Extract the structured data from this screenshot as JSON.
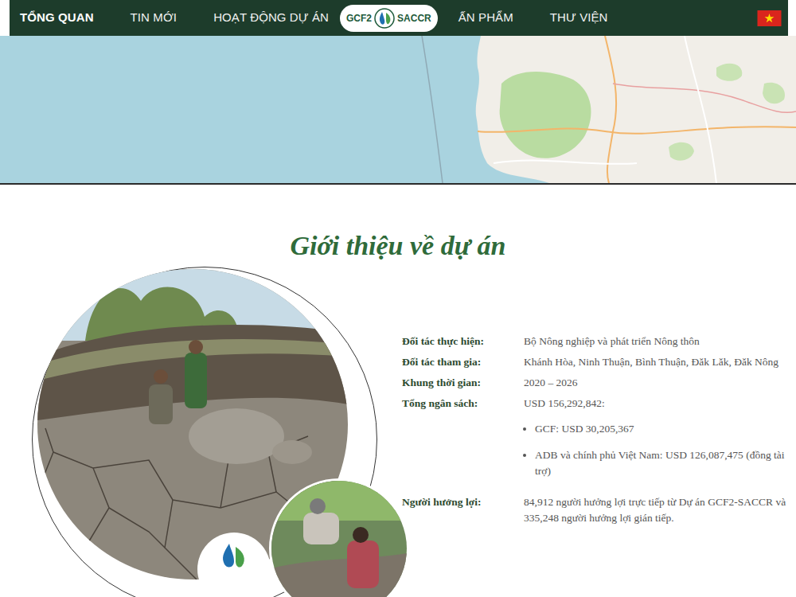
{
  "nav": {
    "items_left": [
      {
        "label": "TỔNG QUAN",
        "selected": true
      },
      {
        "label": "TIN MỚI",
        "selected": false
      },
      {
        "label": "HOẠT ĐỘNG DỰ ÁN",
        "selected": false
      }
    ],
    "logo": {
      "left": "GCF2",
      "right": "SACCR"
    },
    "items_right": [
      {
        "label": "ẤN PHẨM",
        "selected": false
      },
      {
        "label": "THƯ VIỆN",
        "selected": false
      }
    ]
  },
  "intro": {
    "title": "Giới thiệu về dự án",
    "rows": [
      {
        "label": "Đối tác thực hiện:",
        "value": "Bộ Nông nghiệp và phát triển Nông thôn",
        "bullets": []
      },
      {
        "label": "Đối tác tham gia:",
        "value": "Khánh Hòa, Ninh Thuận, Bình Thuận, Đăk Lăk, Đăk Nông",
        "bullets": []
      },
      {
        "label": "Khung thời gian:",
        "value": "2020 – 2026",
        "bullets": []
      },
      {
        "label": "Tổng ngân sách:",
        "value": "USD 156,292,842:",
        "bullets": [
          "GCF: USD 30,205,367",
          "ADB và chính phủ Việt Nam: USD 126,087,475 (đồng tài trợ)"
        ]
      },
      {
        "label": "Người hưởng lợi:",
        "value": "84,912 người hưởng lợi trực tiếp từ Dự án GCF2-SACCR và 335,248 người hưởng lợi gián tiếp.",
        "bullets": []
      }
    ]
  }
}
